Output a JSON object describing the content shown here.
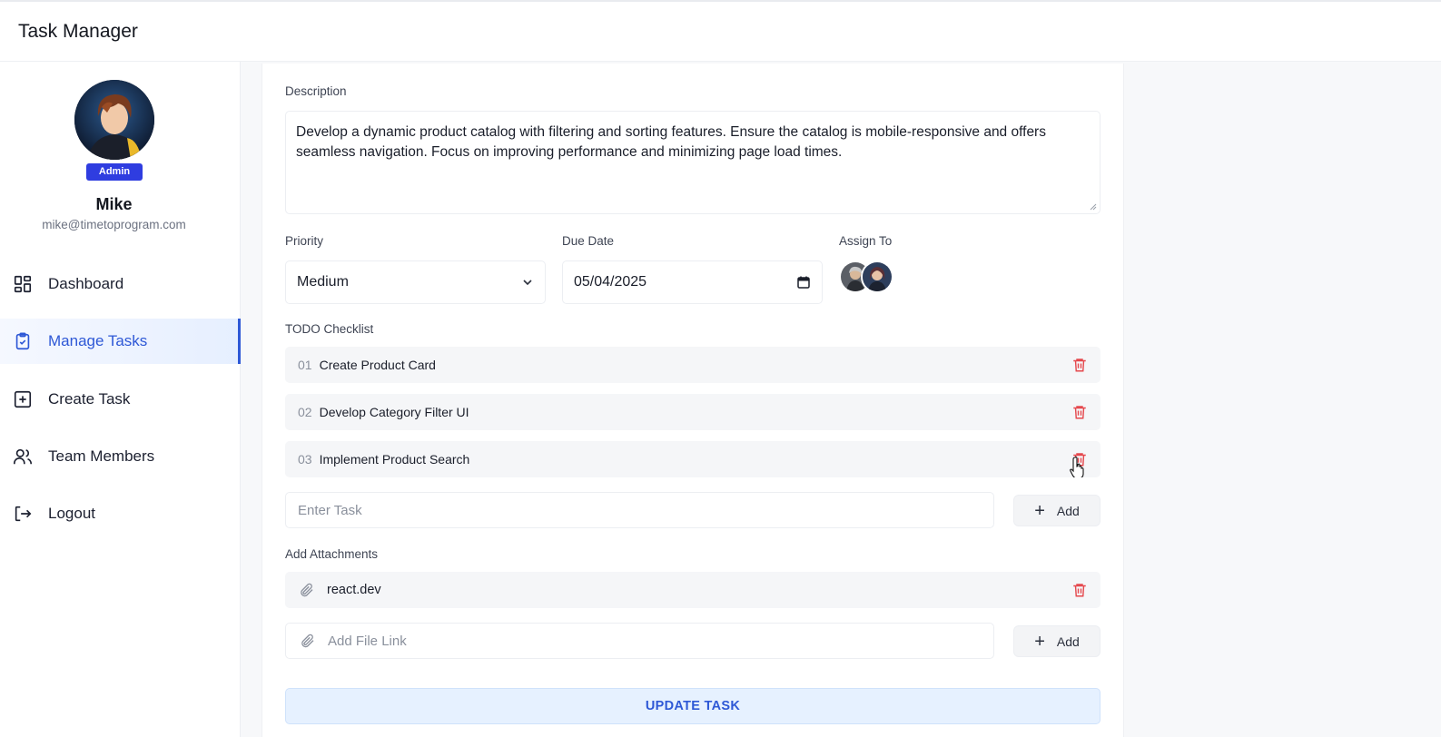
{
  "app": {
    "title": "Task Manager"
  },
  "user": {
    "name": "Mike",
    "email": "mike@timetoprogram.com",
    "role": "Admin"
  },
  "sidebar": {
    "items": [
      {
        "label": "Dashboard",
        "icon": "dashboard-icon",
        "active": false
      },
      {
        "label": "Manage Tasks",
        "icon": "clipboard-check-icon",
        "active": true
      },
      {
        "label": "Create Task",
        "icon": "square-plus-icon",
        "active": false
      },
      {
        "label": "Team Members",
        "icon": "users-icon",
        "active": false
      },
      {
        "label": "Logout",
        "icon": "logout-icon",
        "active": false
      }
    ]
  },
  "form": {
    "description_label": "Description",
    "description_value": "Develop a dynamic product catalog with filtering and sorting features. Ensure the catalog is mobile-responsive and offers seamless navigation. Focus on improving performance and minimizing page load times.",
    "priority_label": "Priority",
    "priority_value": "Medium",
    "due_date_label": "Due Date",
    "due_date_value": "05/04/2025",
    "assign_label": "Assign To",
    "todo_label": "TODO Checklist",
    "todos": [
      {
        "num": "01",
        "text": "Create Product Card"
      },
      {
        "num": "02",
        "text": "Develop Category Filter UI"
      },
      {
        "num": "03",
        "text": "Implement Product Search"
      }
    ],
    "task_placeholder": "Enter Task",
    "add_label": "Add",
    "attachments_label": "Add Attachments",
    "attachments": [
      {
        "text": "react.dev"
      }
    ],
    "file_placeholder": "Add File Link",
    "update_label": "UPDATE TASK"
  },
  "colors": {
    "accent": "#2e58d6",
    "badge": "#2f3de0",
    "danger": "#e5484d"
  }
}
